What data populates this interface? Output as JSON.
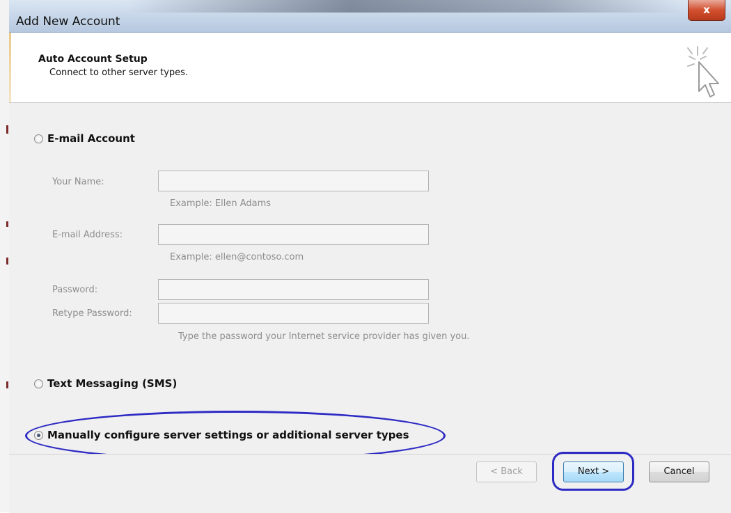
{
  "window": {
    "title": "Add New Account",
    "close_label": "x"
  },
  "header": {
    "title": "Auto Account Setup",
    "subtitle": "Connect to other server types.",
    "icon": "wizard-cursor-icon"
  },
  "options": {
    "email_account": {
      "label": "E-mail Account",
      "selected": false
    },
    "text_messaging": {
      "label": "Text Messaging (SMS)",
      "selected": false
    },
    "manual_configure": {
      "label": "Manually configure server settings or additional server types",
      "selected": true
    }
  },
  "email_form": {
    "your_name_label": "Your Name:",
    "your_name_hint": "Example: Ellen Adams",
    "email_label": "E-mail Address:",
    "email_hint": "Example: ellen@contoso.com",
    "password_label": "Password:",
    "retype_password_label": "Retype Password:",
    "password_hint": "Type the password your Internet service provider has given you."
  },
  "footer": {
    "back_label": "< Back",
    "next_label": "Next >",
    "cancel_label": "Cancel"
  },
  "colors": {
    "annotation": "#2e2bc4",
    "disabled_text": "#8d8d8d"
  }
}
